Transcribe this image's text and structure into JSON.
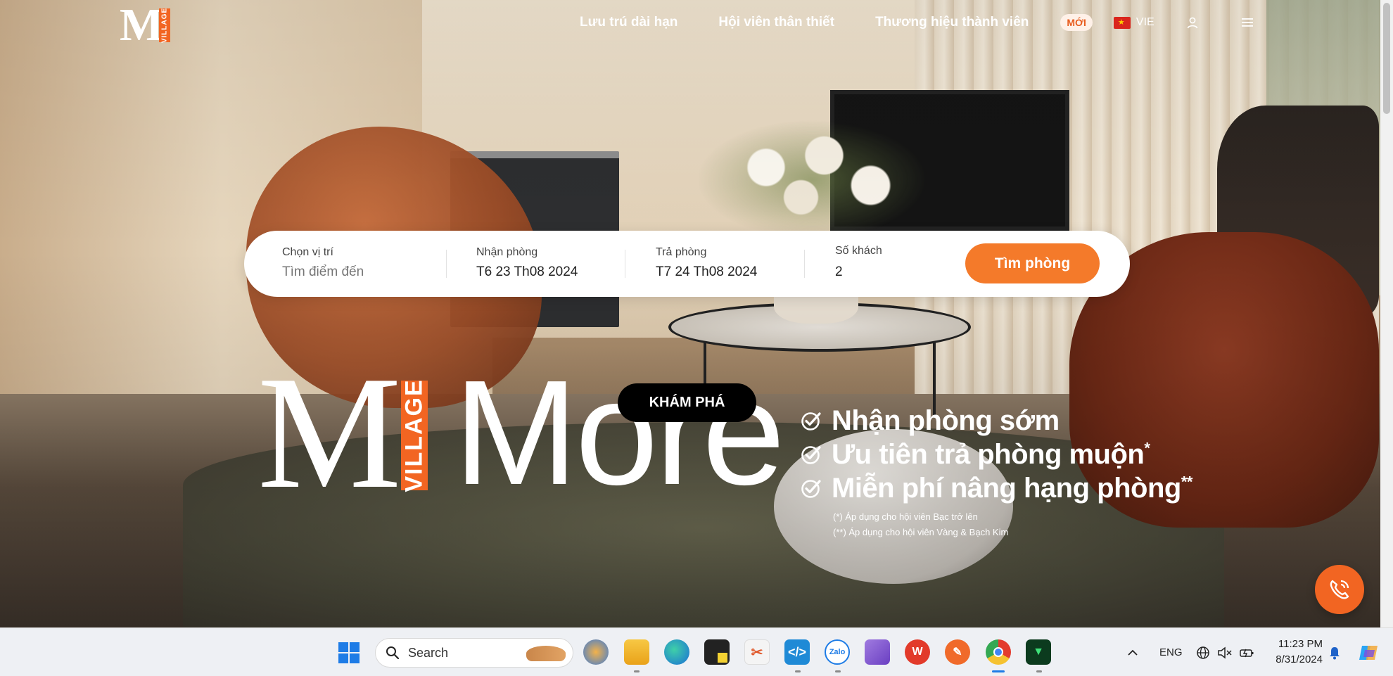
{
  "brand": {
    "logo_letter": "M",
    "logo_sub": "VILLAGE",
    "accent": "#f26522"
  },
  "nav": {
    "links": [
      "Lưu trú dài hạn",
      "Hội viên thân thiết",
      "Thương hiệu thành viên"
    ],
    "new_badge": "MỚI",
    "language": "VIE",
    "icons": {
      "flag": "vietnam-flag-icon",
      "user": "user-icon",
      "menu": "hamburger-menu-icon"
    }
  },
  "search": {
    "location_label": "Chọn vị trí",
    "location_placeholder": "Tìm điểm đến",
    "checkin_label": "Nhận phòng",
    "checkin_value": "T6 23 Th08 2024",
    "checkout_label": "Trả phòng",
    "checkout_value": "T7 24 Th08 2024",
    "guests_label": "Số khách",
    "guests_value": "2",
    "button": "Tìm phòng",
    "button_color": "#f47a2a"
  },
  "promo": {
    "m_letter": "M",
    "village": "VILLAGE",
    "word": "More",
    "explore_button": "KHÁM PHÁ",
    "benefits": [
      {
        "text": "Nhận phòng sớm",
        "mark": ""
      },
      {
        "text": "Ưu tiên trả phòng muộn",
        "mark": "*"
      },
      {
        "text": "Miễn phí nâng hạng phòng",
        "mark": "**"
      }
    ],
    "notes": [
      "(*) Áp dụng cho hội viên Bạc trở lên",
      "(**) Áp dụng cho hội viên Vàng & Bạch Kim"
    ]
  },
  "floating": {
    "call_icon": "phone-call-icon"
  },
  "taskbar": {
    "search_placeholder": "Search",
    "apps": [
      "file-explorer-icon",
      "folder-icon",
      "edge-icon",
      "sticky-notes-icon",
      "snipping-tool-icon",
      "vscode-icon",
      "zalo-icon",
      "visual-studio-icon",
      "wps-office-icon",
      "pen-app-icon",
      "chrome-icon",
      "terminal-icon"
    ],
    "zalo_label": "Zalo",
    "lang": "ENG",
    "time": "11:23 PM",
    "date": "8/31/2024"
  }
}
